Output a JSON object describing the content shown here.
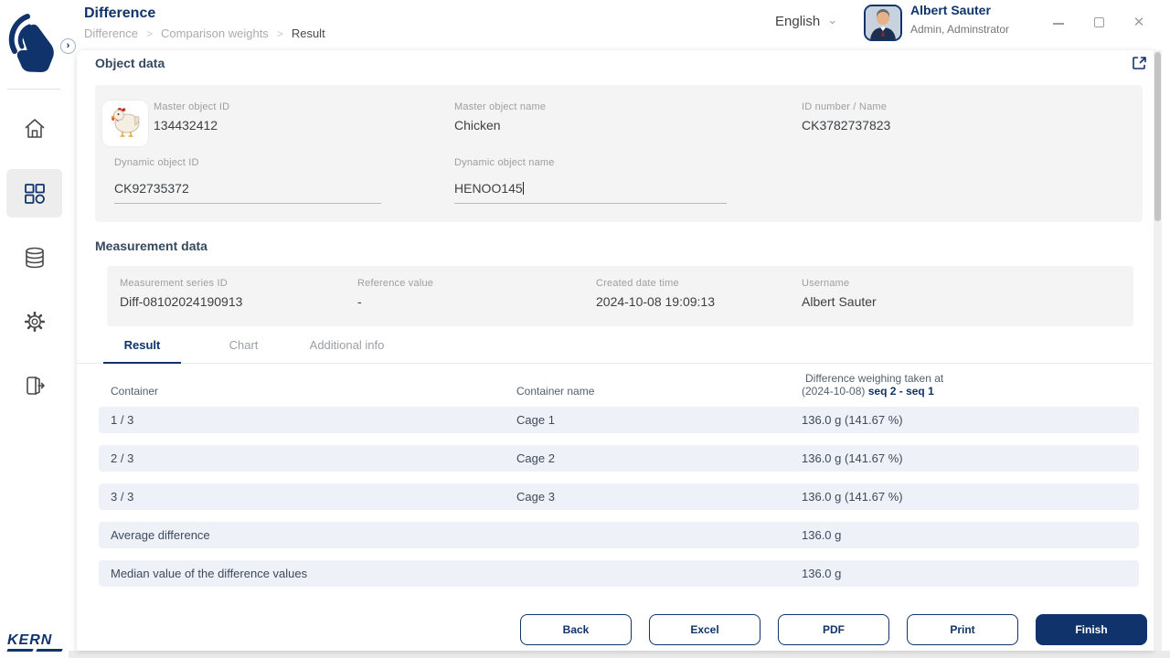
{
  "colors": {
    "accent": "#10336b",
    "row_bg": "#eef1f8",
    "panel_bg": "#f4f4f4"
  },
  "icons": {
    "language_chevron": "⌄",
    "breadcrumb_separator": ">",
    "collapse_chevron": "›",
    "close": "✕"
  },
  "header": {
    "title": "Difference",
    "breadcrumb": {
      "item1": "Difference",
      "item2": "Comparison weights",
      "current": "Result"
    },
    "language": {
      "selected": "English"
    },
    "user": {
      "name": "Albert Sauter",
      "role": "Admin, Adminstrator"
    }
  },
  "sidebar": {
    "brand": "KERN"
  },
  "object_data": {
    "section_title": "Object data",
    "image": "chicken-photo",
    "master_object_id": {
      "label": "Master object ID",
      "value": "134432412"
    },
    "master_object_name": {
      "label": "Master object name",
      "value": "Chicken"
    },
    "id_number_name": {
      "label": "ID number / Name",
      "value": "CK3782737823"
    },
    "dynamic_object_id": {
      "label": "Dynamic object ID",
      "value": "CK92735372"
    },
    "dynamic_object_name": {
      "label": "Dynamic object name",
      "value": "HENOO145"
    }
  },
  "measurement_data": {
    "section_title": "Measurement data",
    "series_id": {
      "label": "Measurement series ID",
      "value": "Diff-08102024190913"
    },
    "reference_value": {
      "label": "Reference value",
      "value": "-"
    },
    "created": {
      "label": "Created date time",
      "value": "2024-10-08 19:09:13"
    },
    "username": {
      "label": "Username",
      "value": "Albert Sauter"
    }
  },
  "tabs": {
    "result": "Result",
    "chart": "Chart",
    "additional": "Additional info"
  },
  "result_table": {
    "columns": {
      "container": "Container",
      "container_name": "Container name",
      "difference_line1": "Difference weighing taken at",
      "difference_line2_prefix": "(2024-10-08)",
      "difference_line2_seq": "seq 2 - seq 1"
    },
    "rows": [
      {
        "container": "1 / 3",
        "name": "Cage 1",
        "value": "136.0 g (141.67 %)"
      },
      {
        "container": "2 / 3",
        "name": "Cage 2",
        "value": "136.0 g (141.67 %)"
      },
      {
        "container": "3 / 3",
        "name": "Cage 3",
        "value": "136.0 g (141.67 %)"
      },
      {
        "container": "Average difference",
        "name": "",
        "value": "136.0 g"
      },
      {
        "container": "Median value of the difference values",
        "name": "",
        "value": "136.0 g"
      }
    ]
  },
  "footer": {
    "back": "Back",
    "excel": "Excel",
    "pdf": "PDF",
    "print": "Print",
    "finish": "Finish"
  }
}
